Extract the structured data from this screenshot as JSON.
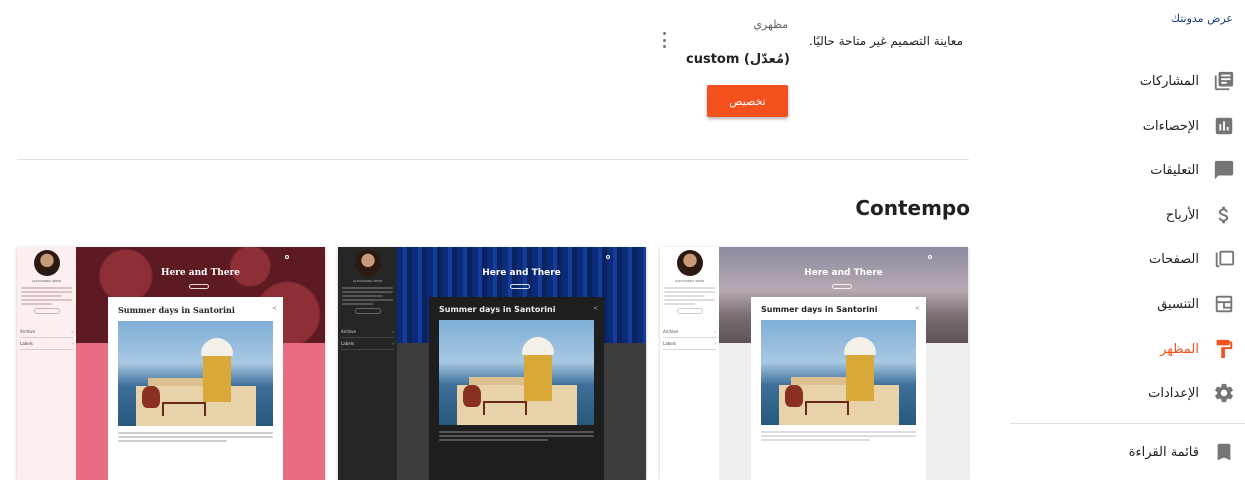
{
  "sidebar": {
    "view_blog": "عرض مدونتك",
    "items": [
      {
        "label": "المشاركات",
        "icon": "posts-icon"
      },
      {
        "label": "الإحصاءات",
        "icon": "stats-icon"
      },
      {
        "label": "التعليقات",
        "icon": "comments-icon"
      },
      {
        "label": "الأرباح",
        "icon": "dollar-icon"
      },
      {
        "label": "الصفحات",
        "icon": "pages-icon"
      },
      {
        "label": "التنسيق",
        "icon": "layout-icon"
      },
      {
        "label": "المظهر",
        "icon": "paint-roller-icon",
        "active": true
      },
      {
        "label": "الإعدادات",
        "icon": "gear-icon"
      },
      {
        "label": "قائمة القراءة",
        "icon": "bookmark-icon"
      }
    ],
    "active_color": "#f4511e"
  },
  "current_theme": {
    "label": "مظهري",
    "name": "custom (مُعدّل)",
    "customize_button": "تخصيص",
    "preview_unavailable": "معاينة التصميم غير متاحة حاليًا."
  },
  "section_title": "Contempo",
  "theme_cards": [
    {
      "variant": "Pink",
      "blog_title": "Here and There",
      "post_title": "Summer days in Santorini",
      "author": "ALEXANDRA SENN",
      "menu": [
        "Archive",
        "Labels"
      ]
    },
    {
      "variant": "Dark",
      "blog_title": "Here and There",
      "post_title": "Summer days in Santorini",
      "author": "ALEXANDRA SENN",
      "menu": [
        "Archive",
        "Labels"
      ]
    },
    {
      "variant": "Light",
      "blog_title": "Here and There",
      "post_title": "Summer days in Santorini",
      "author": "ALEXANDRA SENN",
      "menu": [
        "Archive",
        "Labels"
      ]
    }
  ]
}
